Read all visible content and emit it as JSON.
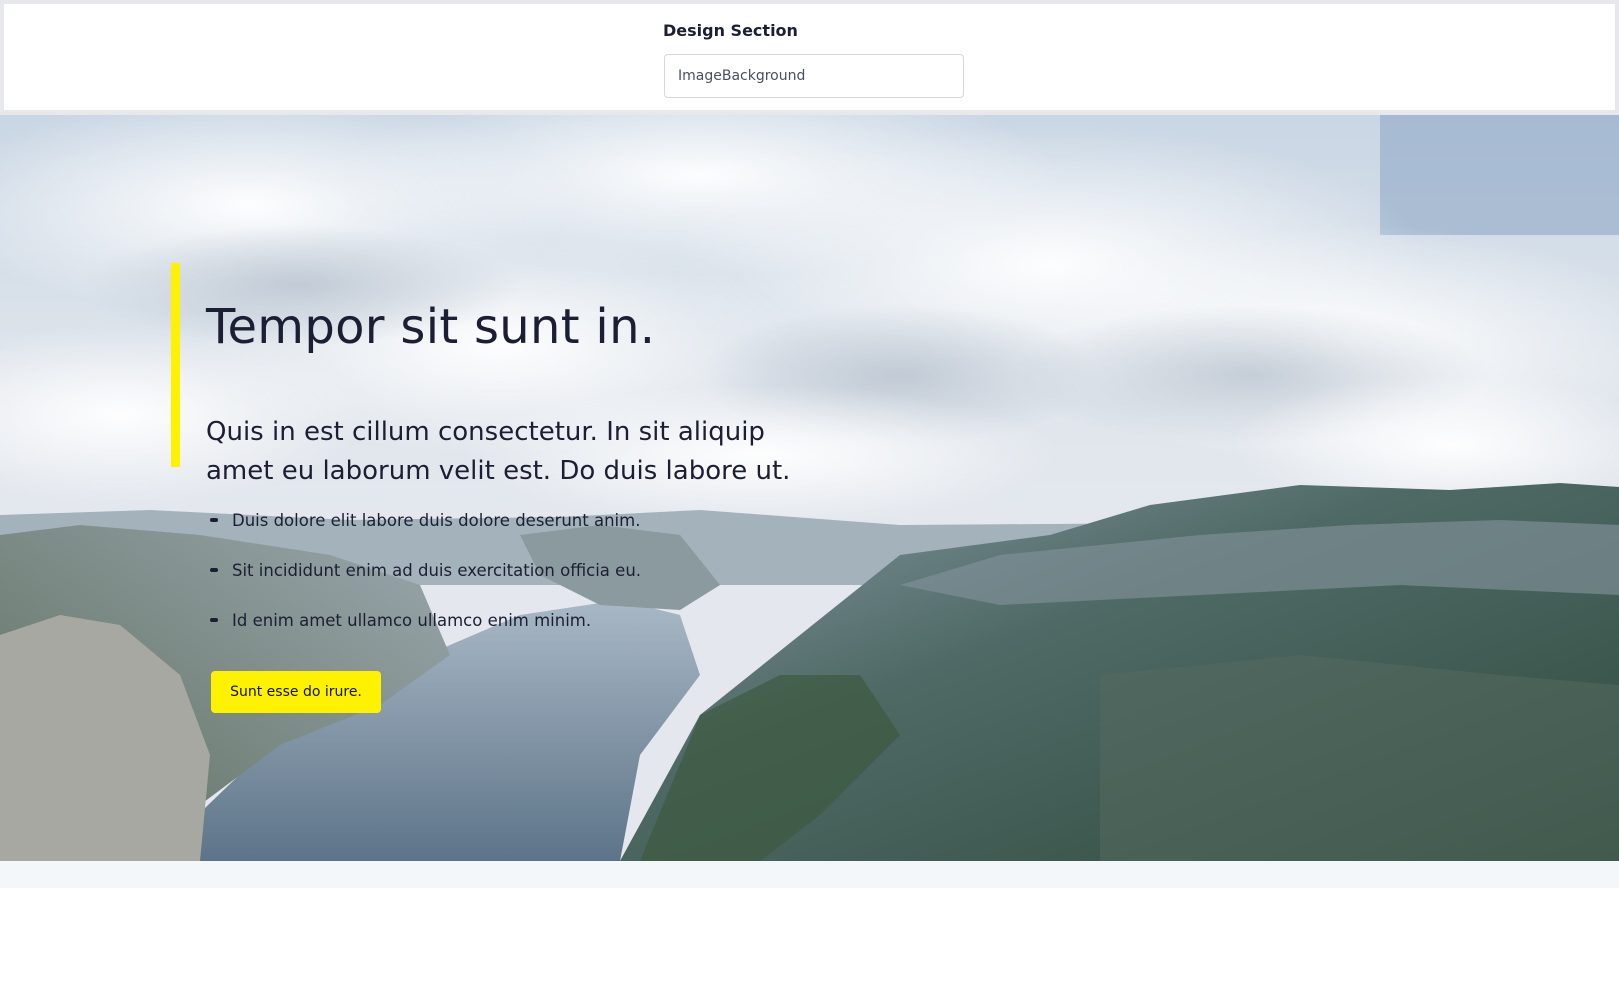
{
  "design": {
    "label": "Design Section",
    "select_value": "ImageBackground"
  },
  "hero": {
    "title": "Tempor sit sunt in.",
    "subtitle": "Quis in est cillum consectetur. In sit aliquip amet eu laborum velit est. Do duis labore ut.",
    "list": [
      "Duis dolore elit labore duis dolore deserunt anim.",
      "Sit incididunt enim ad duis exercitation officia eu.",
      "Id enim amet ullamco ullamco enim minim."
    ],
    "button_label": "Sunt esse do irure.",
    "accent_color": "#fff200",
    "text_color": "#1c1f33"
  },
  "background_image": "mountain-fjord-landscape"
}
